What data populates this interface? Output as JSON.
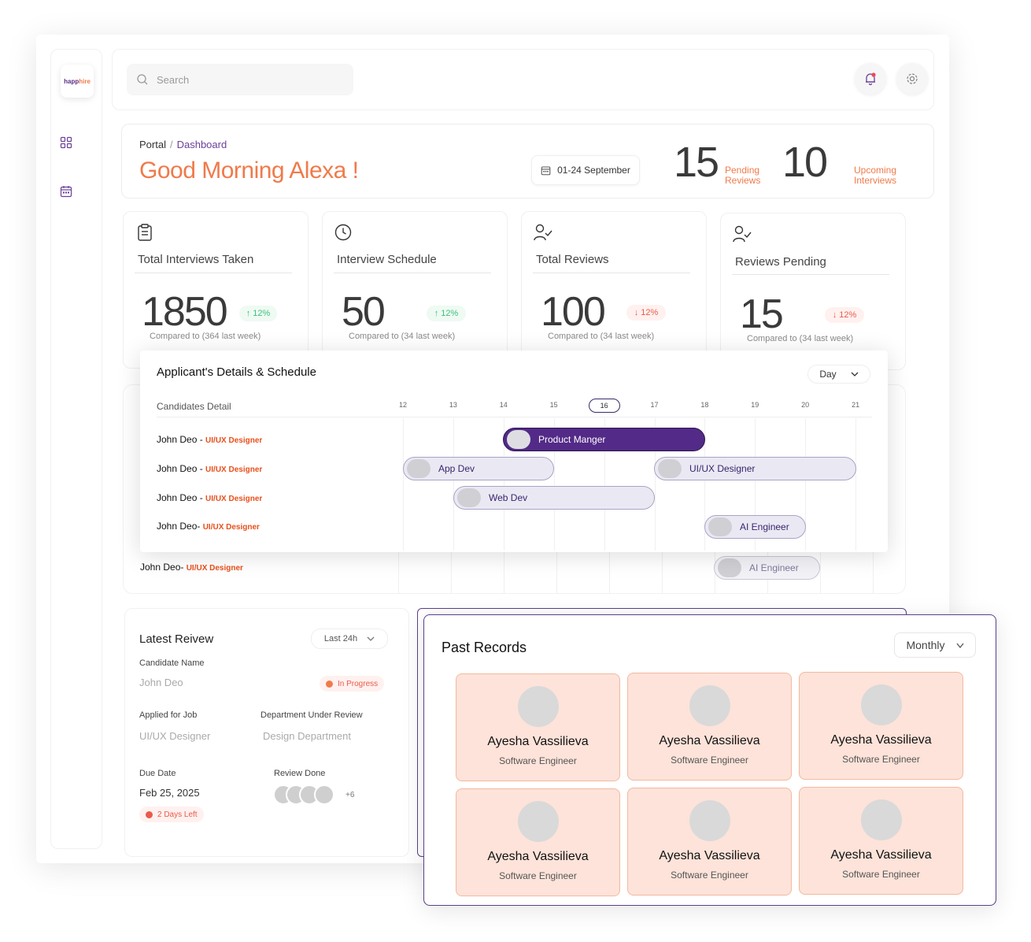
{
  "brand": {
    "logo_part1": "happ",
    "logo_part2": "hire"
  },
  "search": {
    "placeholder": "Search"
  },
  "breadcrumb": {
    "root": "Portal",
    "separator": "/",
    "current": "Dashboard"
  },
  "greeting": "Good Morning Alexa !",
  "date_range": "01-24 September",
  "header_stats": [
    {
      "value": "15",
      "label_line1": "Pending",
      "label_line2": "Reviews"
    },
    {
      "value": "10",
      "label_line1": "Upcoming",
      "label_line2": "Interviews"
    }
  ],
  "stats": [
    {
      "icon": "clipboard-icon",
      "title": "Total Interviews Taken",
      "value": "1850",
      "trend": "12%",
      "direction": "up",
      "compare": "Compared to (364 last week)"
    },
    {
      "icon": "clock-icon",
      "title": "Interview Schedule",
      "value": "50",
      "trend": "12%",
      "direction": "up",
      "compare": "Compared to (34 last week)"
    },
    {
      "icon": "user-check-icon",
      "title": "Total Reviews",
      "value": "100",
      "trend": "12%",
      "direction": "down",
      "compare": "Compared to (34 last week)"
    },
    {
      "icon": "user-check-icon",
      "title": "Reviews Pending",
      "value": "15",
      "trend": "12%",
      "direction": "down",
      "compare": "Compared to (34 last week)"
    }
  ],
  "schedule": {
    "title": "Applicant's Details & Schedule",
    "view": "Day",
    "column_header": "Candidates Detail",
    "days": [
      "12",
      "13",
      "14",
      "15",
      "16",
      "17",
      "18",
      "19",
      "20",
      "21"
    ],
    "selected_day": "16",
    "rows": [
      {
        "name": "John Deo - ",
        "role": "UI/UX Designer"
      },
      {
        "name": "John Deo - ",
        "role": "UI/UX Designer"
      },
      {
        "name": "John Deo - ",
        "role": "UI/UX Designer"
      },
      {
        "name": "John Deo- ",
        "role": "UI/UX Designer"
      }
    ],
    "events": [
      {
        "label": "Product Manger",
        "row": 0,
        "start": "14",
        "end": "18"
      },
      {
        "label": "App Dev",
        "row": 1,
        "start": "12",
        "end": "15"
      },
      {
        "label": "UI/UX Designer",
        "row": 1,
        "start": "17",
        "end": "21"
      },
      {
        "label": "Web Dev",
        "row": 2,
        "start": "13",
        "end": "17"
      },
      {
        "label": "AI Engineer",
        "row": 3,
        "start": "18",
        "end": "20"
      }
    ],
    "underlying_row": {
      "name": "John Deo- ",
      "role": "UI/UX Designer",
      "event": "AI Engineer"
    }
  },
  "latest_review": {
    "title": "Latest Reivew",
    "range": "Last 24h",
    "candidate_label": "Candidate Name",
    "candidate": "John Deo",
    "status": "In Progress",
    "job_label": "Applied for Job",
    "job": "UI/UX Designer",
    "dept_label": "Department Under Review",
    "dept": "Design Department",
    "due_label": "Due Date",
    "due": "Feb 25, 2025",
    "days_left": "2 Days Left",
    "review_done_label": "Review Done",
    "more_count": "+6"
  },
  "past_records": {
    "title": "Past Records",
    "period": "Monthly",
    "people": [
      {
        "name": "Ayesha Vassilieva",
        "role": "Software Engineer"
      },
      {
        "name": "Ayesha Vassilieva",
        "role": "Software Engineer"
      },
      {
        "name": "Ayesha Vassilieva",
        "role": "Software Engineer"
      },
      {
        "name": "Ayesha Vassilieva",
        "role": "Software Engineer"
      },
      {
        "name": "Ayesha Vassilieva",
        "role": "Software Engineer"
      },
      {
        "name": "Ayesha Vassilieva",
        "role": "Software Engineer"
      }
    ]
  },
  "colors": {
    "accent_orange": "#f07a4a",
    "brand_purple": "#532a87",
    "up": "#3fbf7f",
    "down": "#ea5a4a"
  }
}
